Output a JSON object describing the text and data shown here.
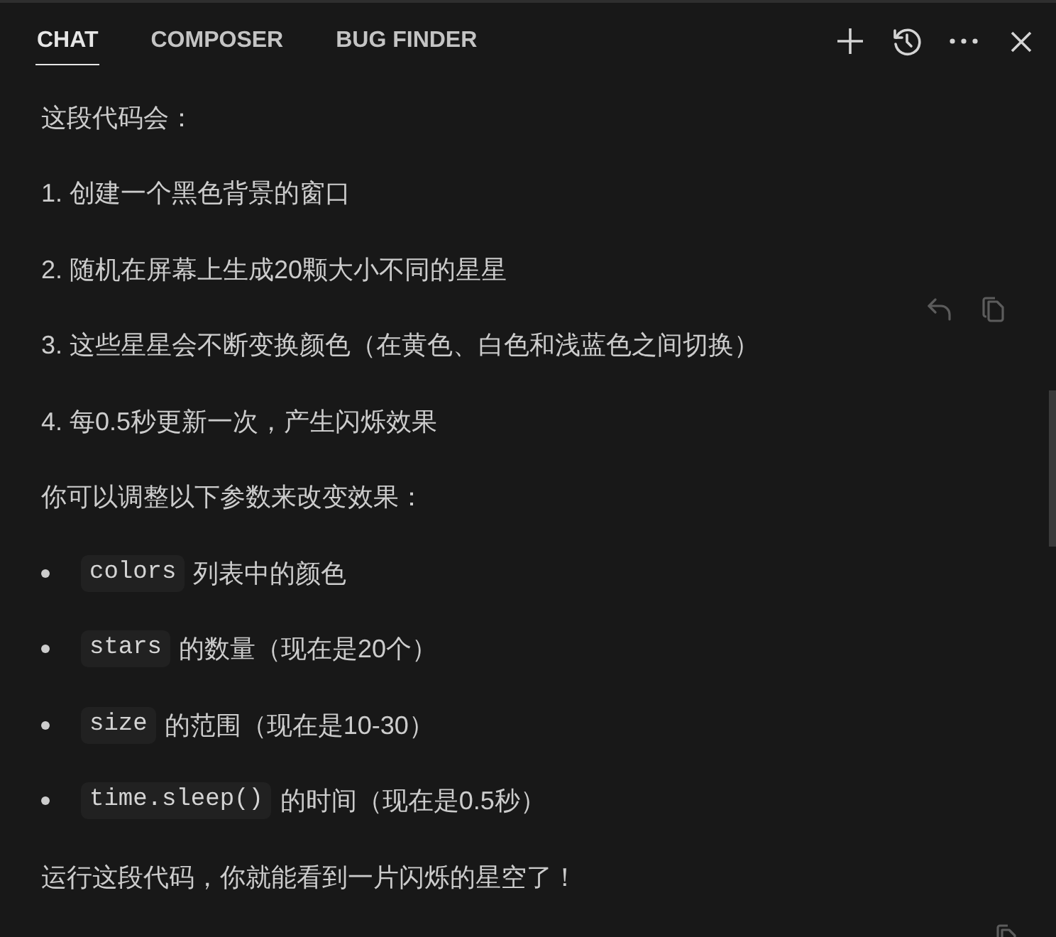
{
  "tabs": [
    {
      "label": "CHAT",
      "selected": true
    },
    {
      "label": "COMPOSER",
      "selected": false
    },
    {
      "label": "BUG FINDER",
      "selected": false
    }
  ],
  "message": {
    "blocks": [
      {
        "kind": "paragraph",
        "text": "这段代码会："
      },
      {
        "kind": "paragraph",
        "text": "1. 创建一个黑色背景的窗口"
      },
      {
        "kind": "paragraph",
        "text": "2. 随机在屏幕上生成20颗大小不同的星星"
      },
      {
        "kind": "paragraph",
        "text": "3. 这些星星会不断变换颜色（在黄色、白色和浅蓝色之间切换）"
      },
      {
        "kind": "paragraph",
        "text": "4. 每0.5秒更新一次，产生闪烁效果"
      },
      {
        "kind": "paragraph",
        "text": "你可以调整以下参数来改变效果："
      },
      {
        "kind": "bullet",
        "code": "colors",
        "text": "列表中的颜色"
      },
      {
        "kind": "bullet",
        "code": "stars",
        "text": "的数量（现在是20个）"
      },
      {
        "kind": "bullet",
        "code": "size",
        "text": "的范围（现在是10-30）"
      },
      {
        "kind": "bullet",
        "code": "time.sleep()",
        "text": "的时间（现在是0.5秒）"
      },
      {
        "kind": "paragraph",
        "text": "运行这段代码，你就能看到一片闪烁的星空了！"
      }
    ]
  }
}
